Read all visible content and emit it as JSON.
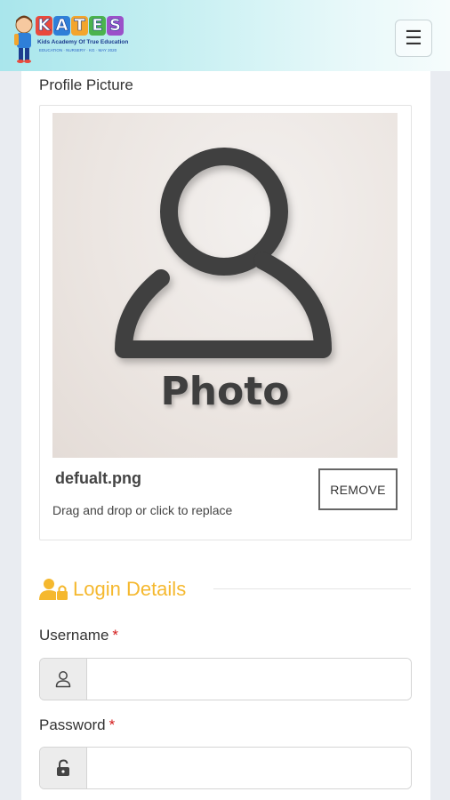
{
  "header": {
    "logo_letters": [
      "K",
      "A",
      "T",
      "E",
      "S"
    ],
    "logo_letter_colors": [
      "#e94a3c",
      "#2f7fd8",
      "#f3a52d",
      "#4bb34d",
      "#9b51c9"
    ],
    "logo_tagline": "Kids Academy Of True Education",
    "logo_subtagline": "EDUCATION · NURSERY · KG · MAY 2020",
    "menu_icon": "hamburger-icon"
  },
  "profile": {
    "label": "Profile Picture",
    "placeholder_text": "Photo",
    "filename": "defualt.png",
    "hint": "Drag and drop or click to replace",
    "remove_label": "REMOVE"
  },
  "login": {
    "title": "Login Details",
    "title_color": "#f5b82e",
    "username_label": "Username",
    "password_label": "Password",
    "required_mark": "*",
    "username_value": "",
    "password_value": ""
  }
}
